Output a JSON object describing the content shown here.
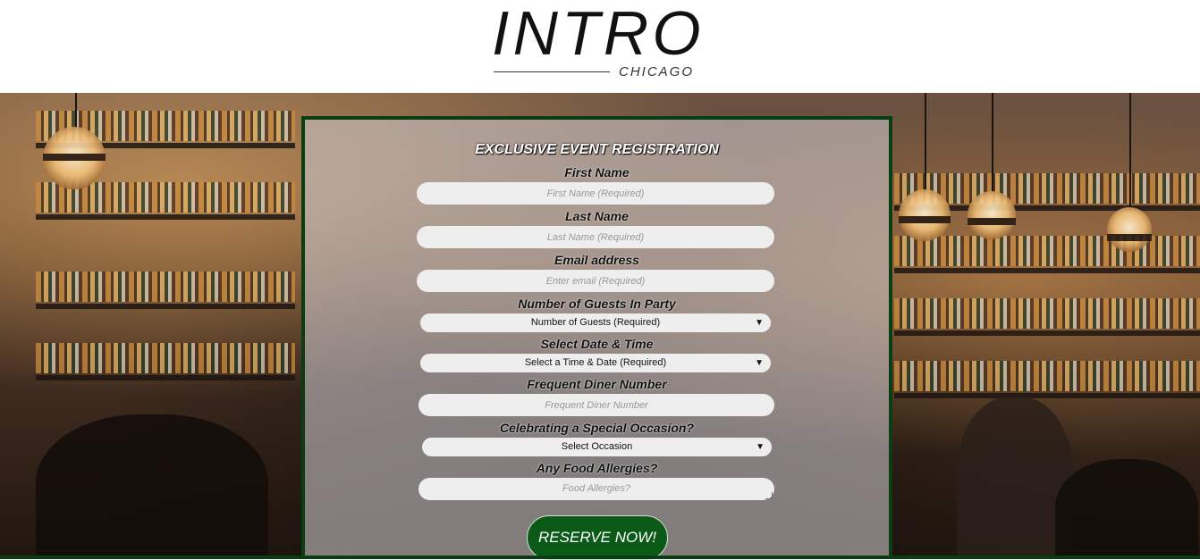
{
  "header": {
    "logo_main": "INTRO",
    "logo_sub": "CHICAGO"
  },
  "form": {
    "title": "EXCLUSIVE EVENT REGISTRATION",
    "first_name": {
      "label": "First Name",
      "placeholder": "First Name (Required)"
    },
    "last_name": {
      "label": "Last Name",
      "placeholder": "Last Name (Required)"
    },
    "email": {
      "label": "Email address",
      "placeholder": "Enter email (Required)"
    },
    "guests": {
      "label": "Number of Guests In Party",
      "selected": "Number of Guests (Required)"
    },
    "datetime": {
      "label": "Select Date & Time",
      "selected": "Select a Time & Date (Required)"
    },
    "diner_number": {
      "label": "Frequent Diner Number",
      "placeholder": "Frequent Diner Number"
    },
    "occasion": {
      "label": "Celebrating a Special Occasion?",
      "selected": "Select Occasion"
    },
    "allergies": {
      "label": "Any Food Allergies?",
      "placeholder": "Food Allergies?"
    },
    "submit_label": "RESERVE NOW!"
  },
  "colors": {
    "accent_green": "#0b5a17",
    "panel_border": "#0b3d12"
  },
  "icons": {
    "select_arrow": "dropdown-arrow-icon",
    "resize_grip": "resize-grip-icon"
  }
}
